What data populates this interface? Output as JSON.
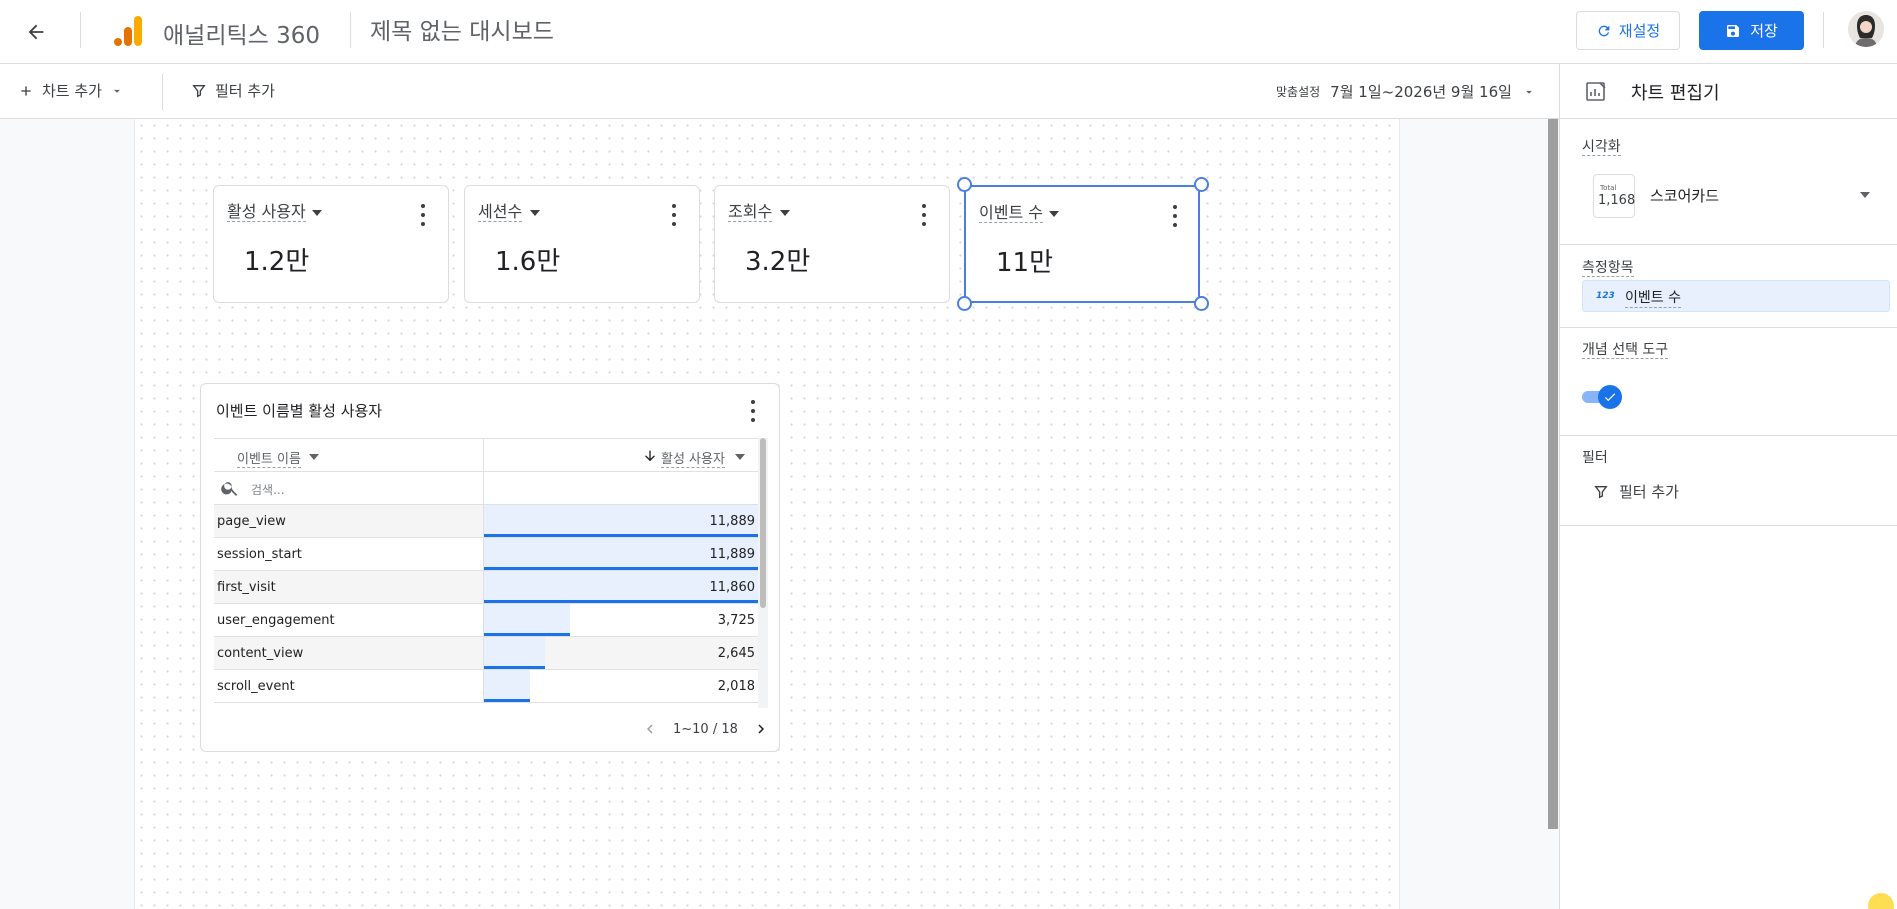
{
  "header": {
    "app_title": "애널리틱스 360",
    "dashboard_title": "제목 없는 대시보드",
    "reset_label": "재설정",
    "save_label": "저장"
  },
  "toolbar": {
    "add_chart_label": "차트 추가",
    "add_filter_label": "필터 추가",
    "date_prefix": "맞춤설정",
    "date_range": "7월 1일~2026년 9월 16일"
  },
  "scorecards": [
    {
      "title": "활성 사용자",
      "value": "1.2만"
    },
    {
      "title": "세션수",
      "value": "1.6만"
    },
    {
      "title": "조회수",
      "value": "3.2만"
    },
    {
      "title": "이벤트 수",
      "value": "11만"
    }
  ],
  "table": {
    "title": "이벤트 이름별 활성 사용자",
    "col_name": "이벤트 이름",
    "col_value": "활성 사용자",
    "search_placeholder": "검색...",
    "rows": [
      {
        "name": "page_view",
        "value": "11,889",
        "fraction": 1.0
      },
      {
        "name": "session_start",
        "value": "11,889",
        "fraction": 1.0
      },
      {
        "name": "first_visit",
        "value": "11,860",
        "fraction": 0.998
      },
      {
        "name": "user_engagement",
        "value": "3,725",
        "fraction": 0.313
      },
      {
        "name": "content_view",
        "value": "2,645",
        "fraction": 0.222
      },
      {
        "name": "scroll_event",
        "value": "2,018",
        "fraction": 0.17
      }
    ],
    "pagination": "1~10 / 18"
  },
  "sidebar": {
    "title": "차트 편집기",
    "visualization_label": "시각화",
    "visualization_icon_total": "Total",
    "visualization_icon_number": "1,168",
    "visualization_value": "스코어카드",
    "metric_label": "측정항목",
    "metric_icon": "123",
    "metric_value": "이벤트 수",
    "concept_label": "개념 선택 도구",
    "concept_enabled": true,
    "filter_label": "필터",
    "filter_add_label": "필터 추가"
  },
  "colors": {
    "accent": "#1a73e8",
    "bar_fill": "#e8f0fe",
    "selection": "#4a7fe0"
  }
}
